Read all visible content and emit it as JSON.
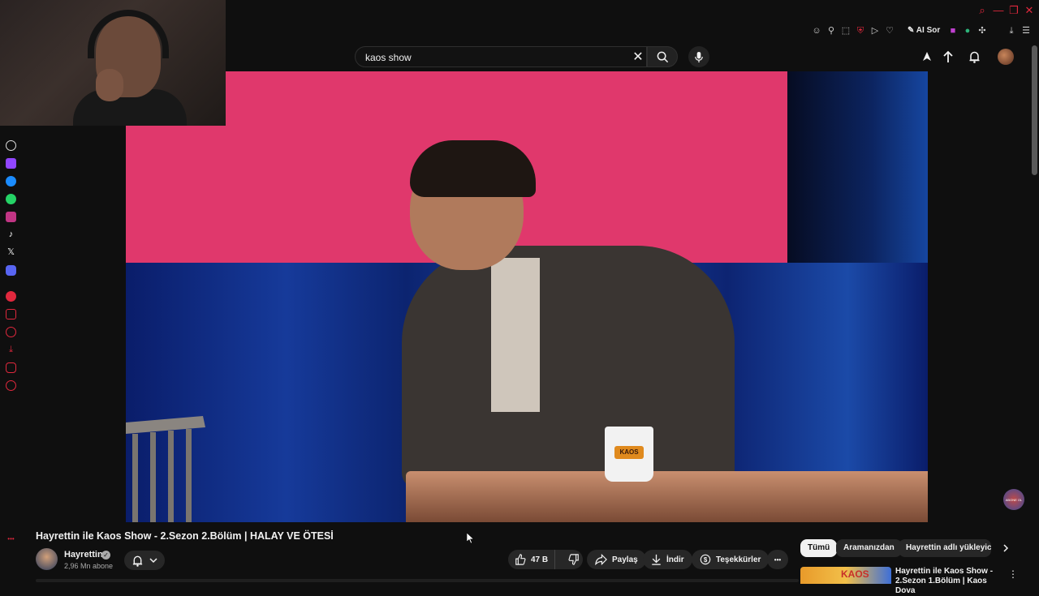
{
  "search": {
    "value": "kaos show",
    "clear_label": "✕"
  },
  "browser": {
    "ai_label": "AI Sor"
  },
  "video": {
    "title": "Hayrettin ile Kaos Show - 2.Sezon 2.Bölüm | HALAY VE ÖTESİ",
    "channel_name": "Hayrettin",
    "subscribers": "2,96 Mn abone",
    "like_count": "47 B",
    "share_label": "Paylaş",
    "download_label": "İndir",
    "thanks_label": "Teşekkürler",
    "more_label": "•••",
    "mug_text": "KAOS"
  },
  "chips": [
    {
      "label": "Tümü"
    },
    {
      "label": "Aramanızdan"
    },
    {
      "label": "Hayrettin adlı yükleyicid"
    }
  ],
  "recommendation": {
    "title": "Hayrettin ile Kaos Show - 2.Sezon 1.Bölüm | Kaos Dova",
    "thumb_text": "KAOS",
    "menu_label": "⋮"
  },
  "subscribe_bubble": "ABONE OL",
  "colors": {
    "background": "#0f0f0f",
    "accent_red": "#e0283d",
    "screen_pink": "#e0386c",
    "curtain_blue": "#163a9a"
  }
}
